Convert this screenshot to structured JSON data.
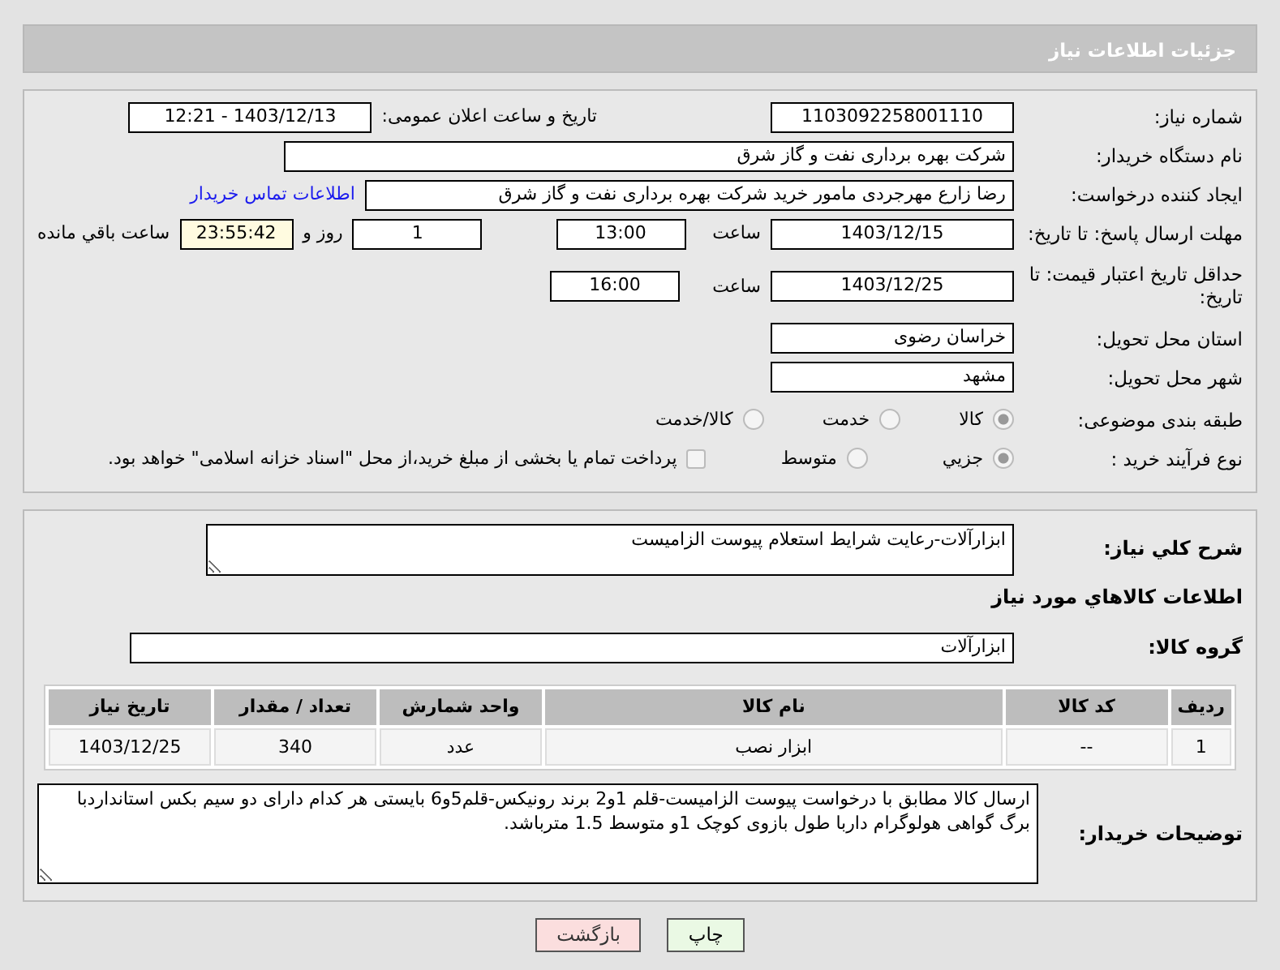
{
  "header": {
    "title": "جزئیات اطلاعات نیاز"
  },
  "need_number": {
    "label": "شماره نیاز:",
    "value": "1103092258001110"
  },
  "announce": {
    "label": "تاریخ و ساعت اعلان عمومی:",
    "value": "1403/12/13 - 12:21"
  },
  "buyer_org": {
    "label": "نام دستگاه خریدار:",
    "value": "شرکت بهره برداری نفت و گاز شرق"
  },
  "creator": {
    "label": "ایجاد کننده درخواست:",
    "value": "رضا زارع مهرجردی مامور خرید شرکت بهره برداری نفت و گاز شرق",
    "link": "اطلاعات تماس خریدار"
  },
  "deadline": {
    "label": "مهلت ارسال پاسخ: تا تاریخ:",
    "date": "1403/12/15",
    "time_label": "ساعت",
    "time": "13:00",
    "days": "1",
    "days_label": "روز و",
    "remaining": "23:55:42",
    "remaining_label": "ساعت باقي مانده"
  },
  "validity": {
    "label": "حداقل تاریخ اعتبار قیمت: تا تاریخ:",
    "date": "1403/12/25",
    "time_label": "ساعت",
    "time": "16:00"
  },
  "province": {
    "label": "استان محل تحویل:",
    "value": "خراسان رضوی"
  },
  "city": {
    "label": "شهر محل تحویل:",
    "value": "مشهد"
  },
  "category": {
    "label": "طبقه بندی موضوعی:",
    "options": [
      {
        "label": "کالا",
        "selected": true
      },
      {
        "label": "خدمت",
        "selected": false
      },
      {
        "label": "کالا/خدمت",
        "selected": false
      }
    ]
  },
  "process": {
    "label": "نوع فرآیند خرید :",
    "options": [
      {
        "label": "جزيي",
        "selected": true
      },
      {
        "label": "متوسط",
        "selected": false
      }
    ],
    "treasury": {
      "label": "پرداخت تمام یا بخشی از مبلغ خرید،از محل \"اسناد خزانه اسلامی\" خواهد بود.",
      "checked": false
    }
  },
  "summary": {
    "label": "شرح كلي نياز:",
    "value": "ابزارآلات-رعایت شرایط استعلام پیوست الزامیست"
  },
  "goods_title": "اطلاعات كالاهاي مورد نياز",
  "goods_group": {
    "label": "گروه کالا:",
    "value": "ابزارآلات"
  },
  "table": {
    "columns": [
      "ردیف",
      "کد کالا",
      "نام کالا",
      "واحد شمارش",
      "تعداد / مقدار",
      "تاریخ نیاز"
    ],
    "rows": [
      [
        "1",
        "--",
        "ابزار نصب",
        "عدد",
        "340",
        "1403/12/25"
      ]
    ]
  },
  "buyer_notes": {
    "label": "توضیحات خریدار:",
    "value": "ارسال کالا مطابق با درخواست پیوست الزامیست-قلم 1و2 برند رونیکس-قلم5و6 بایستی هر کدام دارای دو سیم بکس استانداردبا برگ گواهی هولوگرام داربا طول بازوی کوچک 1و متوسط 1.5 مترباشد."
  },
  "buttons": [
    {
      "label": "چاپ",
      "kind": "print"
    },
    {
      "label": "بازگشت",
      "kind": "back"
    }
  ]
}
